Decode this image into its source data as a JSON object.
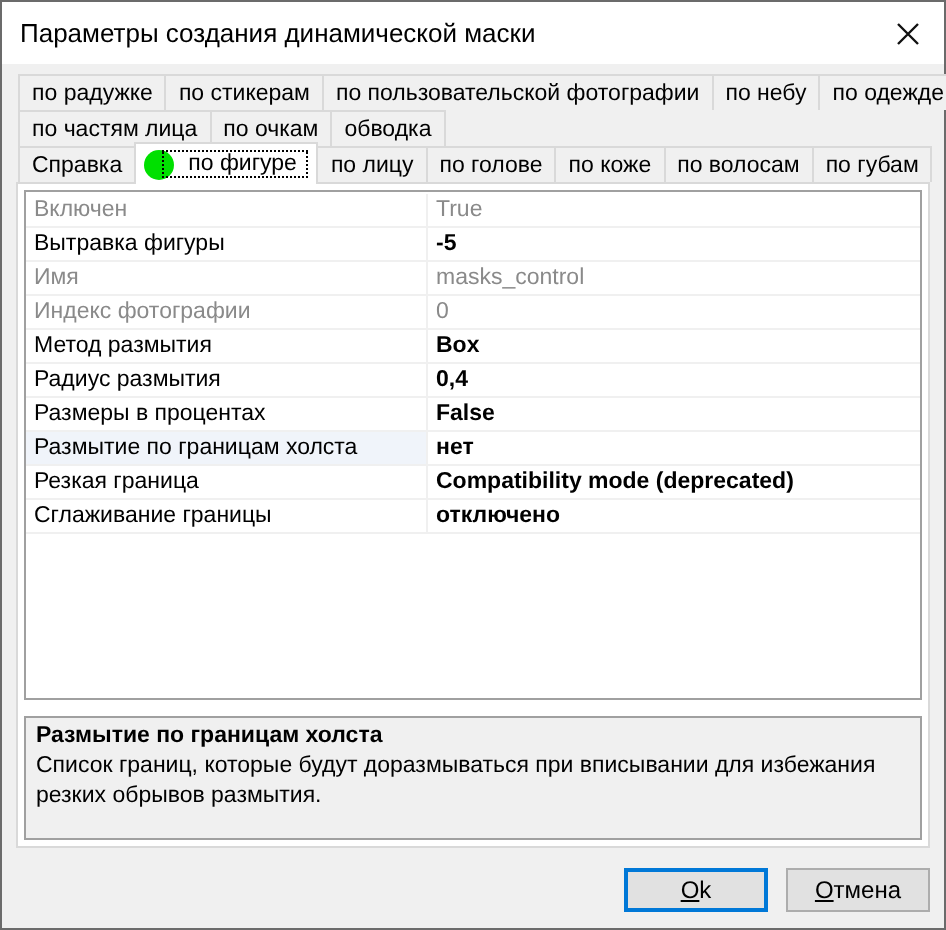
{
  "window": {
    "title": "Параметры создания динамической маски"
  },
  "tab_rows": [
    [
      {
        "label": "по радужке",
        "selected": false,
        "marked": false
      },
      {
        "label": "по стикерам",
        "selected": false,
        "marked": false
      },
      {
        "label": "по пользовательской фотографии",
        "selected": false,
        "marked": false
      },
      {
        "label": "по небу",
        "selected": false,
        "marked": false
      },
      {
        "label": "по одежде",
        "selected": false,
        "marked": false
      }
    ],
    [
      {
        "label": "по частям лица",
        "selected": false,
        "marked": false
      },
      {
        "label": "по очкам",
        "selected": false,
        "marked": false
      },
      {
        "label": "обводка",
        "selected": false,
        "marked": false
      }
    ],
    [
      {
        "label": "Справка",
        "selected": false,
        "marked": false
      },
      {
        "label": "по фигуре",
        "selected": true,
        "marked": true
      },
      {
        "label": "по лицу",
        "selected": false,
        "marked": false
      },
      {
        "label": "по голове",
        "selected": false,
        "marked": false
      },
      {
        "label": "по коже",
        "selected": false,
        "marked": false
      },
      {
        "label": "по волосам",
        "selected": false,
        "marked": false
      },
      {
        "label": "по губам",
        "selected": false,
        "marked": false
      }
    ]
  ],
  "properties": [
    {
      "name": "Включен",
      "value": "True",
      "disabled": true,
      "modified": false,
      "selected": false
    },
    {
      "name": "Вытравка фигуры",
      "value": "-5",
      "disabled": false,
      "modified": true,
      "selected": false
    },
    {
      "name": "Имя",
      "value": "masks_control",
      "disabled": true,
      "modified": false,
      "selected": false
    },
    {
      "name": "Индекс фотографии",
      "value": "0",
      "disabled": true,
      "modified": false,
      "selected": false
    },
    {
      "name": "Метод размытия",
      "value": "Box",
      "disabled": false,
      "modified": true,
      "selected": false
    },
    {
      "name": "Радиус размытия",
      "value": "0,4",
      "disabled": false,
      "modified": true,
      "selected": false
    },
    {
      "name": "Размеры в процентах",
      "value": "False",
      "disabled": false,
      "modified": true,
      "selected": false
    },
    {
      "name": "Размытие по границам холста",
      "value": "нет",
      "disabled": false,
      "modified": true,
      "selected": true
    },
    {
      "name": "Резкая граница",
      "value": "Compatibility mode (deprecated)",
      "disabled": false,
      "modified": true,
      "selected": false
    },
    {
      "name": "Сглаживание границы",
      "value": "отключено",
      "disabled": false,
      "modified": true,
      "selected": false
    }
  ],
  "description": {
    "title": "Размытие по границам холста",
    "text": "Список границ, которые будут доразмываться при вписывании для избежания резких обрывов размытия."
  },
  "buttons": [
    {
      "label": "Ok",
      "default": true
    },
    {
      "label": "Отмена",
      "default": false
    }
  ]
}
